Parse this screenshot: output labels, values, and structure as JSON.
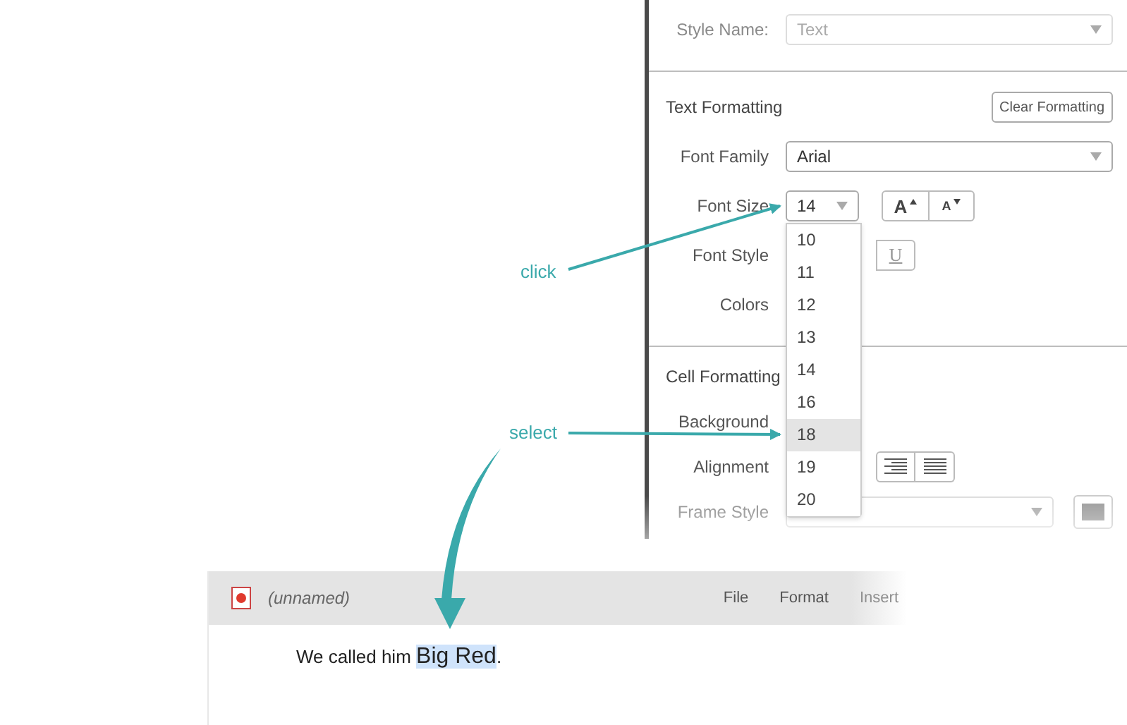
{
  "panel": {
    "style_name": {
      "label": "Style Name:",
      "value": "Text",
      "disabled": true
    },
    "text_formatting": {
      "title": "Text Formatting",
      "clear_button": "Clear Formatting",
      "rows": [
        {
          "kind": "select",
          "label": "Font Family",
          "value": "Arial"
        },
        {
          "kind": "size",
          "label": "Font Size",
          "value": "14",
          "buttons": [
            "A",
            "A"
          ]
        },
        {
          "kind": "style",
          "label": "Font Style",
          "buttons": [
            "U"
          ]
        },
        {
          "kind": "colors",
          "label": "Colors"
        }
      ]
    },
    "cell_formatting": {
      "title": "Cell Formatting",
      "rows": [
        {
          "kind": "background",
          "label": "Background"
        },
        {
          "kind": "alignment",
          "label": "Alignment"
        },
        {
          "kind": "frame",
          "label": "Frame Style"
        }
      ]
    }
  },
  "size_dropdown": {
    "options": [
      {
        "label": "10",
        "selected": false
      },
      {
        "label": "11",
        "selected": false
      },
      {
        "label": "12",
        "selected": false
      },
      {
        "label": "13",
        "selected": false
      },
      {
        "label": "14",
        "selected": false
      },
      {
        "label": "16",
        "selected": false
      },
      {
        "label": "18",
        "selected": true
      },
      {
        "label": "19",
        "selected": false
      },
      {
        "label": "20",
        "selected": false
      }
    ]
  },
  "annotations": [
    {
      "kind": "click",
      "text": "click"
    },
    {
      "kind": "select",
      "text": "select"
    }
  ],
  "editor": {
    "title": "(unnamed)",
    "menu": [
      "File",
      "Format",
      "Insert"
    ],
    "sentence": {
      "before": "We called him ",
      "selection": "Big Red",
      "after": "."
    }
  }
}
